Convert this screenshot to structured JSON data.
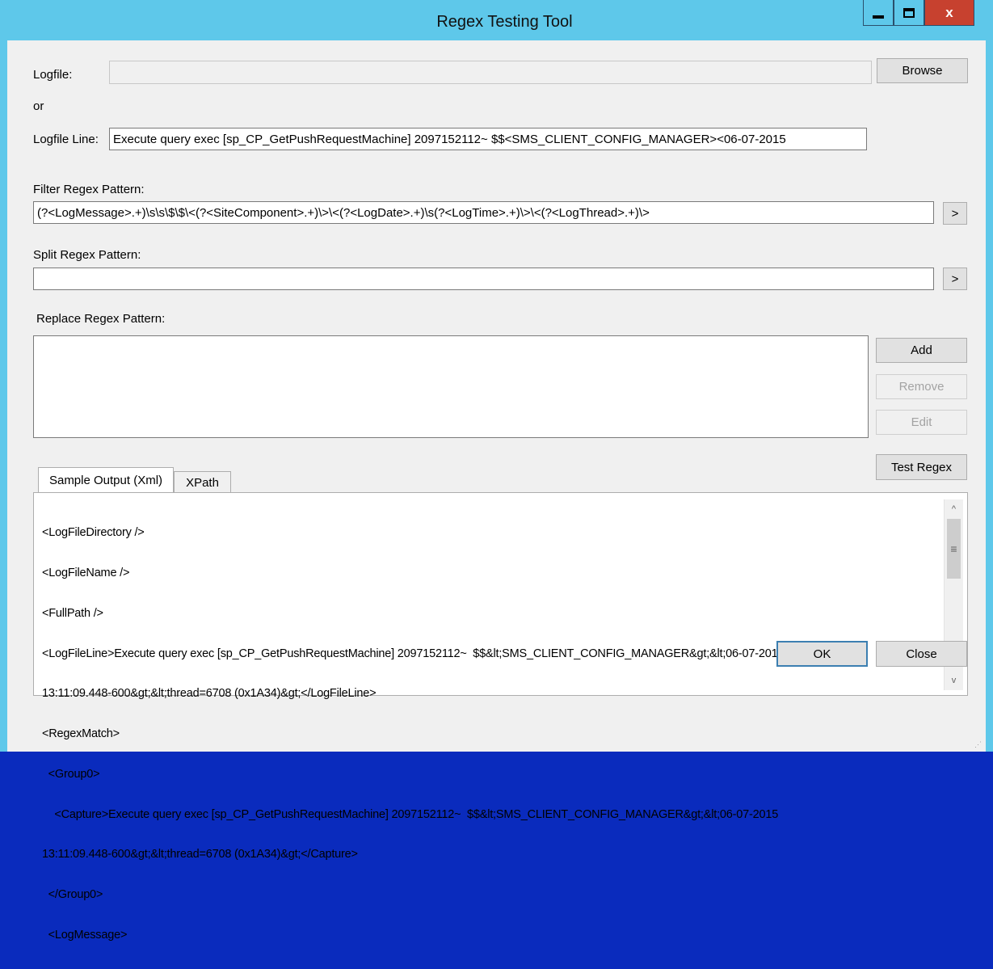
{
  "window": {
    "title": "Regex Testing Tool",
    "minimize_icon": "minimize-icon",
    "maximize_icon": "maximize-icon",
    "close_label": "x"
  },
  "logfile": {
    "label": "Logfile:",
    "value": "",
    "browse_label": "Browse"
  },
  "or_label": "or",
  "logfile_line": {
    "label": "Logfile Line:",
    "value": "Execute query exec [sp_CP_GetPushRequestMachine] 2097152112~  $$<SMS_CLIENT_CONFIG_MANAGER><06-07-2015"
  },
  "filter": {
    "label": "Filter Regex Pattern:",
    "value": "(?<LogMessage>.+)\\s\\s\\$\\$\\<(?<SiteComponent>.+)\\>\\<(?<LogDate>.+)\\s(?<LogTime>.+)\\>\\<(?<LogThread>.+)\\>",
    "go_label": ">"
  },
  "split": {
    "label": "Split Regex Pattern:",
    "value": "",
    "go_label": ">"
  },
  "replace": {
    "label": "Replace Regex Pattern:",
    "add_label": "Add",
    "remove_label": "Remove",
    "edit_label": "Edit"
  },
  "test_regex_label": "Test Regex",
  "tabs": [
    {
      "label": "Sample Output (Xml)",
      "active": true
    },
    {
      "label": "XPath",
      "active": false
    }
  ],
  "output_lines": [
    "<LogFileDirectory />",
    "<LogFileName />",
    "<FullPath />",
    "<LogFileLine>Execute query exec [sp_CP_GetPushRequestMachine] 2097152112~  $$&lt;SMS_CLIENT_CONFIG_MANAGER&gt;&lt;06-07-2015",
    "13:11:09.448-600&gt;&lt;thread=6708 (0x1A34)&gt;</LogFileLine>",
    "<RegexMatch>",
    "  <Group0>",
    "    <Capture>Execute query exec [sp_CP_GetPushRequestMachine] 2097152112~  $$&lt;SMS_CLIENT_CONFIG_MANAGER&gt;&lt;06-07-2015",
    "13:11:09.448-600&gt;&lt;thread=6708 (0x1A34)&gt;</Capture>",
    "  </Group0>",
    "  <LogMessage>"
  ],
  "scroll": {
    "up_glyph": "^",
    "down_glyph": "v",
    "thumb_glyph": "≡"
  },
  "footer": {
    "ok_label": "OK",
    "close_label": "Close"
  }
}
